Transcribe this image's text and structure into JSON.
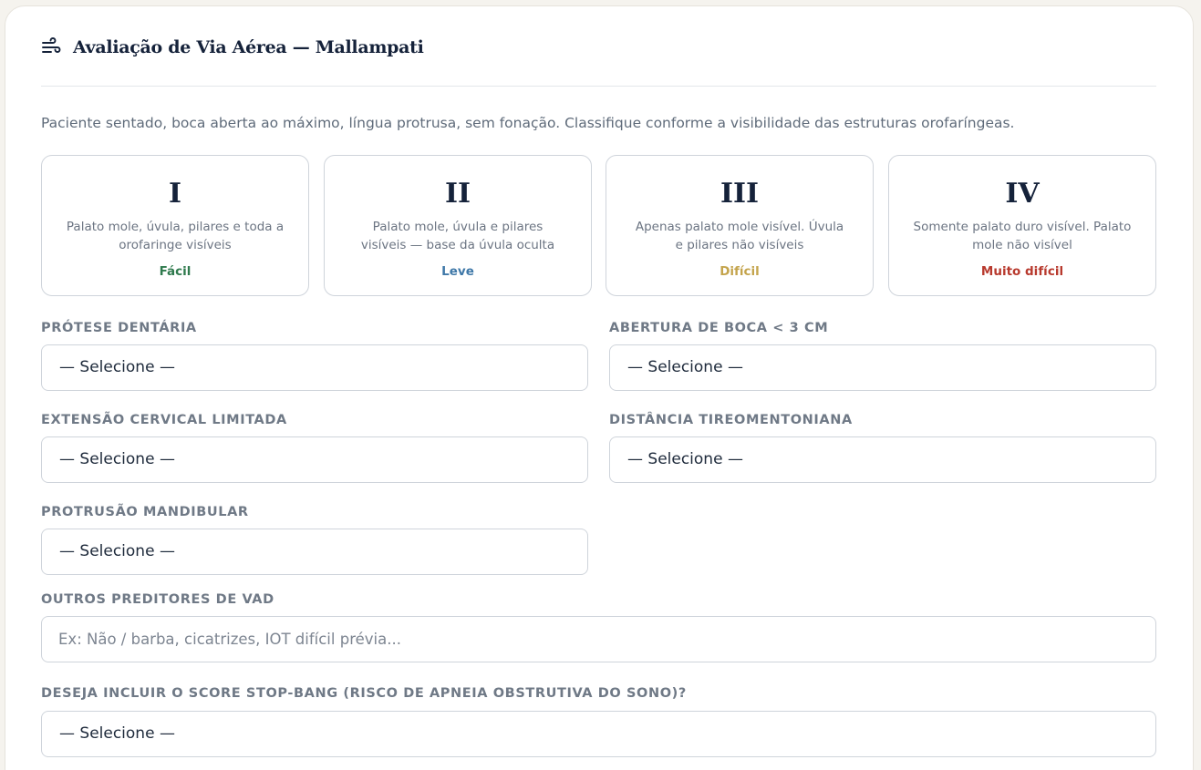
{
  "header": {
    "title": "Avaliação de Via Aérea — Mallampati",
    "icon": "wind-icon"
  },
  "intro": "Paciente sentado, boca aberta ao máximo, língua protrusa, sem fonação. Classifique conforme a visibilidade das estruturas orofaríngeas.",
  "grades": [
    {
      "numeral": "I",
      "description": "Palato mole, úvula, pilares e toda a orofaringe visíveis",
      "difficulty": "Fácil",
      "color": "#2f7a4d"
    },
    {
      "numeral": "II",
      "description": "Palato mole, úvula e pilares visíveis — base da úvula oculta",
      "difficulty": "Leve",
      "color": "#3f78a8"
    },
    {
      "numeral": "III",
      "description": "Apenas palato mole visível. Úvula e pilares não visíveis",
      "difficulty": "Difícil",
      "color": "#c4a44c"
    },
    {
      "numeral": "IV",
      "description": "Somente palato duro visível. Palato mole não visível",
      "difficulty": "Muito difícil",
      "color": "#b83a2e"
    }
  ],
  "fields": {
    "protese": {
      "label": "PRÓTESE DENTÁRIA",
      "value": "— Selecione —"
    },
    "abertura": {
      "label": "ABERTURA DE BOCA < 3 CM",
      "value": "— Selecione —"
    },
    "extensao": {
      "label": "EXTENSÃO CERVICAL LIMITADA",
      "value": "— Selecione —"
    },
    "distancia": {
      "label": "DISTÂNCIA TIREOMENTONIANA",
      "value": "— Selecione —"
    },
    "protrusao": {
      "label": "PROTRUSÃO MANDIBULAR",
      "value": "— Selecione —"
    },
    "outros": {
      "label": "OUTROS PREDITORES DE VAD",
      "placeholder": "Ex: Não / barba, cicatrizes, IOT difícil prévia..."
    },
    "stopbang": {
      "label": "DESEJA INCLUIR O SCORE STOP-BANG (RISCO DE APNEIA OBSTRUTIVA DO SONO)?",
      "value": "— Selecione —"
    }
  }
}
